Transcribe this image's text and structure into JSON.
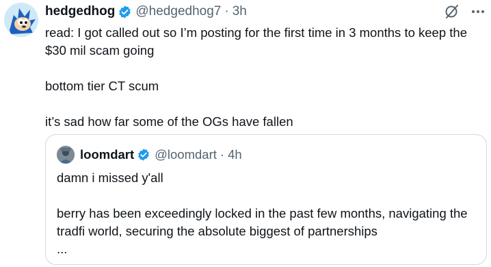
{
  "post": {
    "author_name": "hedgedhog",
    "author_handle": "@hedgedhog7",
    "separator": "·",
    "time": "3h",
    "verified_icon": "verified-badge-icon",
    "paragraphs": [
      "read: I got called out so I’m posting for the first time in 3 months to keep the $30 mil scam going",
      "bottom tier CT scum",
      "it’s sad how far some of the OGs have fallen"
    ]
  },
  "quote": {
    "author_name": "loomdart",
    "author_handle": "@loomdart",
    "separator": "·",
    "time": "4h",
    "paragraphs": [
      "damn i missed y'all",
      "berry has been exceedingly locked in the past few months, navigating the tradfi world, securing the absolute biggest of partnerships",
      "..."
    ]
  },
  "actions": {
    "grok_icon": "grok-icon",
    "more_icon": "more-options-icon"
  },
  "colors": {
    "text": "#0f1419",
    "secondary": "#536471",
    "verified": "#1d9bf0",
    "border": "#cfd9de"
  }
}
